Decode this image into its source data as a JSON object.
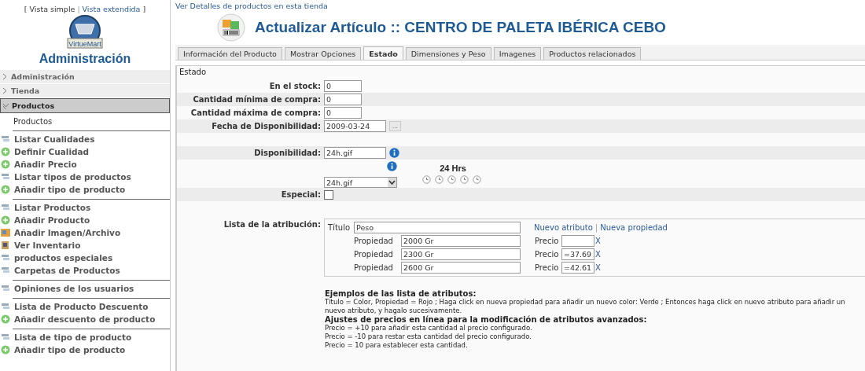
{
  "sidebar": {
    "view_open": "[",
    "view_links": [
      "Vista simple",
      "Vista extendida"
    ],
    "view_separator": "|",
    "view_close": "]",
    "logo_text": "VirtueMart",
    "title": "Administración",
    "sections": [
      {
        "label": "Administración",
        "expanded": false
      },
      {
        "label": "Tienda",
        "expanded": false
      },
      {
        "label": "Productos",
        "expanded": true
      }
    ],
    "groups": [
      [
        {
          "label": "Productos",
          "kind": "plain"
        }
      ],
      [
        {
          "label": "Listar Cualidades",
          "kind": "list"
        },
        {
          "label": "Definir Cualidad",
          "kind": "add"
        },
        {
          "label": "Añadir Precio",
          "kind": "add"
        },
        {
          "label": "Listar tipos de productos",
          "kind": "list"
        },
        {
          "label": "Añadir tipo de producto",
          "kind": "add"
        }
      ],
      [
        {
          "label": "Listar Productos",
          "kind": "list"
        },
        {
          "label": "Añadir Producto",
          "kind": "add"
        },
        {
          "label": "Añadir Imagen/Archivo",
          "kind": "image"
        },
        {
          "label": "Ver Inventario",
          "kind": "inventory"
        },
        {
          "label": "productos especiales",
          "kind": "list"
        },
        {
          "label": "Carpetas de Productos",
          "kind": "list"
        }
      ],
      [
        {
          "label": "Opiniones de los usuarios",
          "kind": "list"
        }
      ],
      [
        {
          "label": "Lista de Producto Descuento",
          "kind": "list"
        },
        {
          "label": "Añadir descuento de producto",
          "kind": "add"
        }
      ],
      [
        {
          "label": "Lista de tipo de producto",
          "kind": "list"
        },
        {
          "label": "Añadir tipo de producto",
          "kind": "add"
        }
      ]
    ]
  },
  "top_link": "Ver Detalles de productos en esta tienda",
  "page_title": "Actualizar Artículo :: CENTRO DE PALETA IBÉRICA CEBO",
  "tabs": [
    {
      "label": "Información del Producto",
      "selected": false
    },
    {
      "label": "Mostrar Opciones",
      "selected": false
    },
    {
      "label": "Estado",
      "selected": true
    },
    {
      "label": "Dimensiones y Peso",
      "selected": false
    },
    {
      "label": "Imagenes",
      "selected": false
    },
    {
      "label": "Productos relacionados",
      "selected": false
    }
  ],
  "section_title": "Estado",
  "fields": [
    {
      "kind": "text",
      "label": "En el stock:",
      "value": "0"
    },
    {
      "kind": "text",
      "label": "Cantidad mínima de compra:",
      "value": "0"
    },
    {
      "kind": "text",
      "label": "Cantidad máxima de compra:",
      "value": "0"
    },
    {
      "kind": "date",
      "label": "Fecha de Disponibilidad:",
      "value": "2009-03-24",
      "button": "..."
    },
    {
      "kind": "spacer"
    },
    {
      "kind": "info",
      "label": "Disponibilidad:",
      "value": "24h.gif"
    },
    {
      "kind": "picker",
      "value": "24h.gif",
      "preview": "24 Hrs"
    },
    {
      "kind": "checkbox",
      "label": "Especial:",
      "checked": false
    },
    {
      "kind": "spacer"
    }
  ],
  "attributes": {
    "label": "Lista de la atribución:",
    "title_label": "Título",
    "title_value": "Peso",
    "links": [
      "Nuevo atributo",
      "Nueva propiedad"
    ],
    "links_separator": "|",
    "properties": [
      {
        "label": "Propiedad",
        "value": "2000 Gr",
        "price_label": "Precio",
        "remove": "X"
      },
      {
        "label": "Propiedad",
        "value": "2300 Gr",
        "price_label": "Precio",
        "price": "=37.69",
        "remove": "X"
      },
      {
        "label": "Propiedad",
        "value": "2600 Gr",
        "price_label": "Precio",
        "price": "=42.61",
        "remove": "X"
      }
    ]
  },
  "notes": [
    {
      "kind": "heading",
      "text": "Ejemplos de las lista de atributos:"
    },
    {
      "kind": "line",
      "text": "Título = Color, Propiedad = Rojo ; Haga click en nueva propiedad para añadir un nuevo color: Verde ; Entonces haga click en nuevo atributo para añadir un nuevo atributo, y hagalo sucesivamente."
    },
    {
      "kind": "heading",
      "text": "Ajustes de precios en línea para la modificación de atributos avanzados:"
    },
    {
      "kind": "line",
      "text": "Precio = +10 para añadir esta cantidad al precio configurado."
    },
    {
      "kind": "line",
      "text": "Precio = -10 para restar esta cantidad del precio configurado."
    },
    {
      "kind": "line",
      "text": "Precio = 10 para establecer esta cantidad."
    }
  ]
}
